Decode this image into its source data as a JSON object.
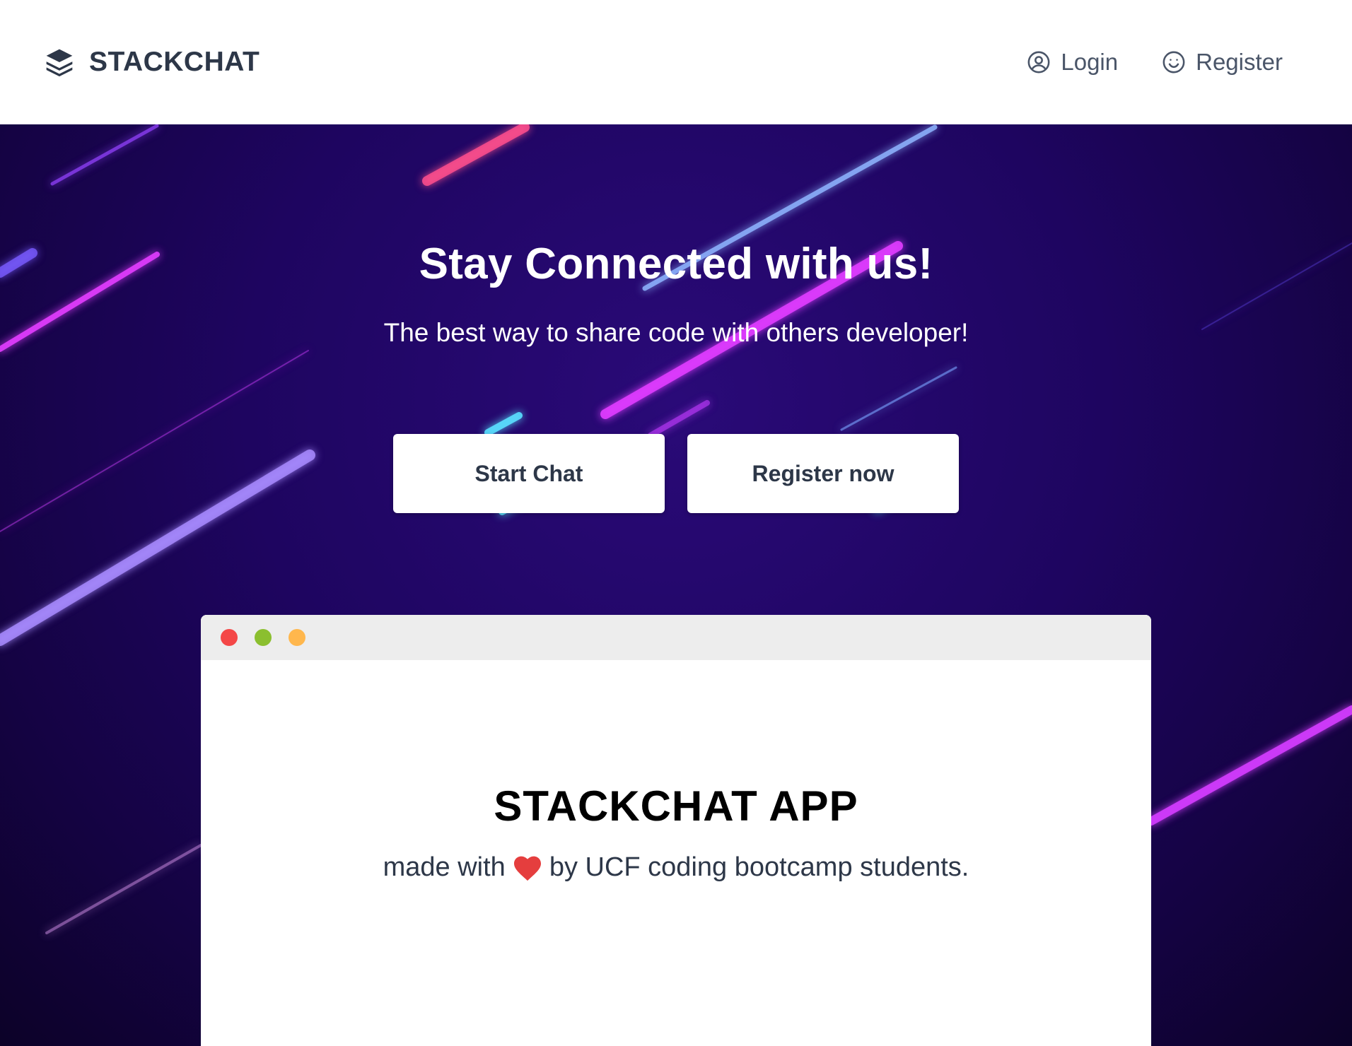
{
  "header": {
    "brand": {
      "name": "STACKCHAT",
      "icon": "layers-icon"
    },
    "nav": {
      "login": {
        "label": "Login",
        "icon": "user-circle-icon"
      },
      "register": {
        "label": "Register",
        "icon": "smiley-icon"
      }
    }
  },
  "hero": {
    "title": "Stay Connected with us!",
    "subtitle": "The best way to share code with others developer!",
    "buttons": {
      "start_chat": "Start Chat",
      "register_now": "Register now"
    }
  },
  "mockup": {
    "title": "STACKCHAT APP",
    "tagline_before": "made with",
    "tagline_icon": "heart-icon",
    "tagline_after": "by UCF coding bootcamp students.",
    "window_dots": [
      "#f44747",
      "#8bbf2f",
      "#ffb74d"
    ]
  },
  "colors": {
    "text_dark": "#2d3748",
    "nav_text": "#4a5568",
    "hero_bg": "#1e0560",
    "heart": "#e53e3e"
  }
}
